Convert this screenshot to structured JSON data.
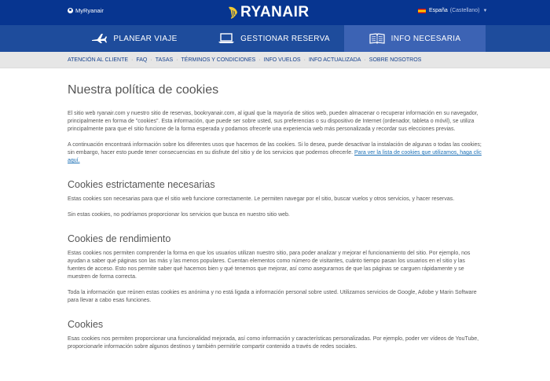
{
  "topbar": {
    "my_account": "MyRyanair",
    "brand": "RYANAIR",
    "language": "España",
    "language_sub": "(Castellano)"
  },
  "nav": {
    "tabs": [
      {
        "label": "PLANEAR VIAJE",
        "icon": "plane-icon",
        "active": false
      },
      {
        "label": "GESTIONAR RESERVA",
        "icon": "laptop-icon",
        "active": false
      },
      {
        "label": "INFO NECESARIA",
        "icon": "book-icon",
        "active": true
      }
    ]
  },
  "subnav": {
    "items": [
      "ATENCIÓN AL CLIENTE",
      "FAQ",
      "TASAS",
      "TÉRMINOS Y CONDICIONES",
      "INFO VUELOS",
      "INFO ACTUALIZADA",
      "SOBRE NOSOTROS"
    ]
  },
  "page": {
    "title": "Nuestra política de cookies",
    "intro1": "El sitio web ryanair.com y nuestro sitio de reservas, bookryanair.com, al igual que la mayoría de sitios web, pueden almacenar o recuperar información en su navegador, principalmente en forma de \"cookies\". Esta información, que puede ser sobre usted, sus preferencias o su dispositivo de Internet (ordenador, tableta o móvil), se utiliza principalmente para que el sitio funcione de la forma esperada y podamos ofrecerle una experiencia web más personalizada y recordar sus elecciones previas.",
    "intro2": "A continuación encontrará información sobre los diferentes usos que hacemos de las cookies. Si lo desea, puede desactivar la instalación de algunas o todas las cookies; sin embargo, hacer esto puede tener consecuencias en su disfrute del sitio y de los servicios que podemos ofrecerle.",
    "intro2_link": "Para ver la lista de cookies que utilizamos, haga clic aquí.",
    "s1_title": "Cookies estrictamente necesarias",
    "s1_p1": "Estas cookies son necesarias para que el sitio web funcione correctamente. Le permiten navegar por el sitio, buscar vuelos y otros servicios, y hacer reservas.",
    "s1_p2": "Sin estas cookies, no podríamos proporcionar los servicios que busca en nuestro sitio web.",
    "s2_title": "Cookies de rendimiento",
    "s2_p1": "Estas cookies nos permiten comprender la forma en que los usuarios utilizan nuestro sitio, para poder analizar y mejorar el funcionamiento del sitio. Por ejemplo, nos ayudan a saber qué páginas son las más y las menos populares. Cuentan elementos como número de visitantes, cuánto tiempo pasan los usuarios en el sitio y las fuentes de acceso. Esto nos permite saber qué hacemos bien y qué tenemos que mejorar, así como asegurarnos de que las páginas se carguen rápidamente y se muestren de forma correcta.",
    "s2_p2": "Toda la información que reúnen estas cookies es anónima y no está ligada a información personal sobre usted. Utilizamos servicios de Google, Adobe y Marin Software para llevar a cabo esas funciones.",
    "s3_title": "Cookies",
    "s3_p1": "Esas cookies nos permiten proporcionar una funcionalidad mejorada, así como información y características personalizadas. Por ejemplo, poder ver vídeos de YouTube, proporcionarle información sobre algunos destinos y también permitirle compartir contenido a través de redes sociales."
  }
}
